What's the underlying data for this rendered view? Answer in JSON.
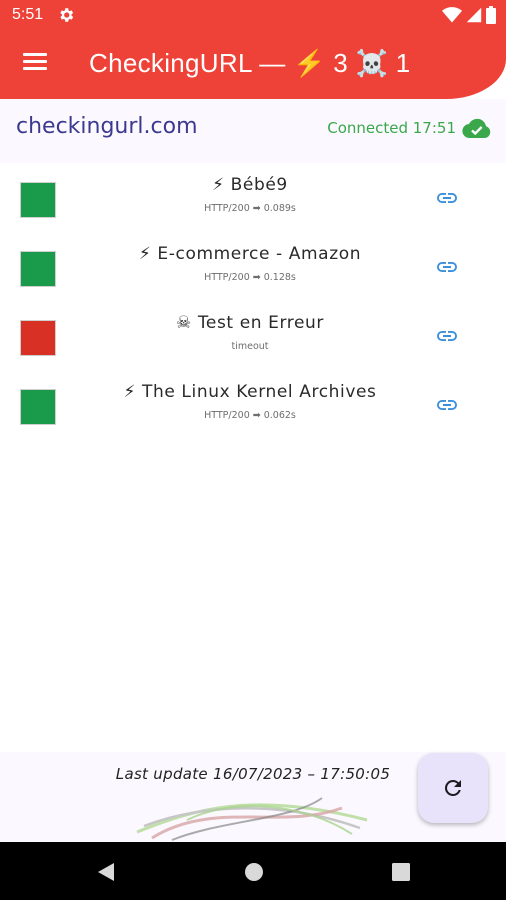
{
  "status_bar": {
    "time": "5:51",
    "icons": [
      "gear-icon",
      "wifi-icon",
      "signal-icon",
      "battery-icon"
    ]
  },
  "app_bar": {
    "title": "CheckingURL — ⚡ 3  ☠️ 1",
    "menu_icon": "hamburger-menu-icon"
  },
  "header": {
    "site": "checkingurl.com",
    "status": "Connected 17:51",
    "status_icon": "cloud-check-icon"
  },
  "colors": {
    "app_bar": "#ee4238",
    "ok": "#1a9a4b",
    "error": "#d93026",
    "link": "#3b8fdc",
    "connected": "#3aa84a"
  },
  "sites": [
    {
      "title": "⚡ Bébé9",
      "subtitle": "HTTP/200 ➡ 0.089s",
      "status": "ok"
    },
    {
      "title": "⚡ E-commerce - Amazon",
      "subtitle": "HTTP/200 ➡ 0.128s",
      "status": "ok"
    },
    {
      "title": "☠ Test en Erreur",
      "subtitle": "timeout",
      "status": "error"
    },
    {
      "title": "⚡ The Linux Kernel Archives",
      "subtitle": "HTTP/200 ➡ 0.062s",
      "status": "ok"
    }
  ],
  "footer": {
    "last_update": "Last update 16/07/2023 – 17:50:05",
    "refresh_icon": "refresh-icon"
  },
  "nav_bar": {
    "buttons": [
      "back-icon",
      "home-icon",
      "recents-icon"
    ]
  }
}
